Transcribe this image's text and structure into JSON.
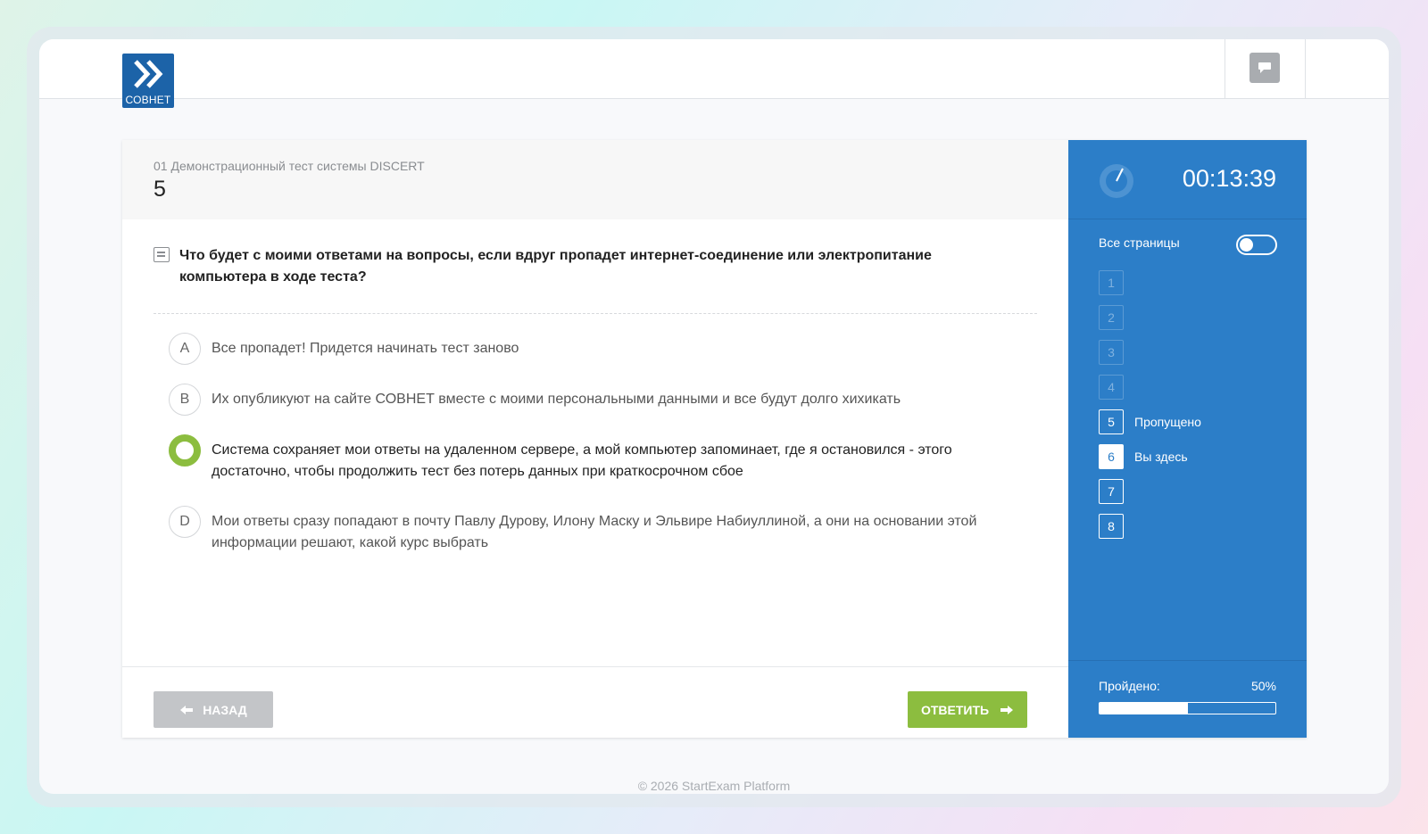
{
  "logo": {
    "text": "СОВНЕТ"
  },
  "header": {
    "chat_icon": "chat-bubble-icon"
  },
  "question": {
    "test_name": "01 Демонстрационный тест системы DISCERT",
    "page_number": "5",
    "text": "Что будет с моими ответами на вопросы, если вдруг пропадет интернет-соединение или электропитание компьютера в ходе теста?",
    "options": [
      {
        "letter": "A",
        "text": "Все пропадет! Придется начинать тест заново",
        "selected": false
      },
      {
        "letter": "B",
        "text": "Их опубликуют на сайте СОВНЕТ вместе с моими персональными данными и все будут долго хихикать",
        "selected": false
      },
      {
        "letter": "",
        "text": "Система сохраняет мои ответы на удаленном сервере, а мой компьютер запоминает, где я остановился - этого достаточно, чтобы продолжить тест без потерь данных при краткосрочном сбое",
        "selected": true
      },
      {
        "letter": "D",
        "text": "Мои ответы сразу попадают в почту Павлу Дурову, Илону Маску и Эльвире Набиуллиной, а они на основании этой информации решают, какой курс выбрать",
        "selected": false
      }
    ]
  },
  "buttons": {
    "back": "НАЗАД",
    "answer": "ОТВЕТИТЬ"
  },
  "sidebar": {
    "timer": "00:13:39",
    "all_pages_label": "Все страницы",
    "all_pages_on": false,
    "pages": [
      {
        "number": "1",
        "status": "",
        "state": "unvisited"
      },
      {
        "number": "2",
        "status": "",
        "state": "unvisited"
      },
      {
        "number": "3",
        "status": "",
        "state": "unvisited"
      },
      {
        "number": "4",
        "status": "",
        "state": "unvisited"
      },
      {
        "number": "5",
        "status": "Пропущено",
        "state": "visited"
      },
      {
        "number": "6",
        "status": "Вы здесь",
        "state": "current"
      },
      {
        "number": "7",
        "status": "",
        "state": "visited"
      },
      {
        "number": "8",
        "status": "",
        "state": "visited"
      }
    ],
    "progress_label": "Пройдено:",
    "progress_value": "50%",
    "progress_fraction": 0.5
  },
  "footer": {
    "copyright": "© 2026 StartExam Platform"
  },
  "colors": {
    "accent_blue": "#2c7ec8",
    "accent_green": "#8cbd3f",
    "logo_blue": "#1c63a8"
  }
}
